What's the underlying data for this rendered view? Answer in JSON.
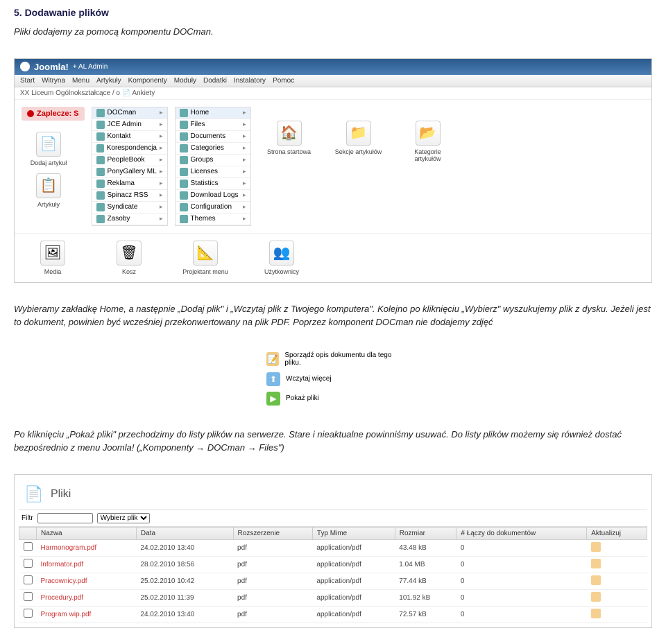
{
  "doc": {
    "heading": "5. Dodawanie plików",
    "para1": "Pliki dodajemy za pomocą komponentu DOCman.",
    "para2": "Wybieramy zakładkę Home, a następnie „Dodaj plik\" i „Wczytaj plik z Twojego komputera\". Kolejno po kliknięciu „Wybierz\" wyszukujemy plik z dysku. Jeżeli jest to dokument, powinien być wcześniej przekonwertowany na plik PDF. Poprzez komponent DOCman nie dodajemy zdjęć",
    "para3": "Po kliknięciu „Pokaż pliki\" przechodzimy do listy plików na serwerze. Stare i nieaktualne powinniśmy usuwać. Do listy plików możemy się również dostać bezpośrednio z menu Joomla! („Komponenty → DOCman → Files\")"
  },
  "joomla": {
    "brand": "Joomla!",
    "brand_suffix": " + AL Admin",
    "menu": [
      "Start",
      "Witryna",
      "Menu",
      "Artykuły",
      "Komponenty",
      "Moduły",
      "Dodatki",
      "Instalatory",
      "Pomoc"
    ],
    "breadcrumb": "XX Liceum Ogólnokształcące / o 📄 Ankiety",
    "zaplecze": "Zaplecze: S",
    "menu_col1": [
      {
        "label": "DOCman",
        "highlighted": true
      },
      {
        "label": "JCE Admin"
      },
      {
        "label": "Kontakt"
      },
      {
        "label": "Korespondencja"
      },
      {
        "label": "PeopleBook"
      },
      {
        "label": "PonyGallery ML"
      },
      {
        "label": "Reklama"
      },
      {
        "label": "Spinacz RSS"
      },
      {
        "label": "Syndicate"
      },
      {
        "label": "Zasoby"
      }
    ],
    "menu_col2": [
      {
        "label": "Home",
        "highlighted": true
      },
      {
        "label": "Files"
      },
      {
        "label": "Documents"
      },
      {
        "label": "Categories"
      },
      {
        "label": "Groups"
      },
      {
        "label": "Licenses"
      },
      {
        "label": "Statistics"
      },
      {
        "label": "Download Logs"
      },
      {
        "label": "Configuration"
      },
      {
        "label": "Themes"
      }
    ],
    "big_icons_top": [
      {
        "label": "Dodaj artykuł"
      },
      {
        "label": "Artykuły"
      }
    ],
    "big_icons_right": [
      {
        "label": "Strona startowa"
      },
      {
        "label": "Sekcje artykułów"
      },
      {
        "label": "Kategorie artykułów"
      }
    ],
    "bottom_icons": [
      {
        "label": "Media"
      },
      {
        "label": "Kosz"
      },
      {
        "label": "Projektant menu"
      },
      {
        "label": "Użytkownicy"
      }
    ]
  },
  "actions": {
    "doc": "Sporządź opis dokumentu dla tego pliku.",
    "upload": "Wczytaj więcej",
    "show": "Pokaż pliki"
  },
  "files": {
    "title": "Pliki",
    "filter_label": "Filtr",
    "filter_placeholder": "Wybierz plik",
    "columns": [
      "",
      "Nazwa",
      "Data",
      "Rozszerzenie",
      "Typ Mime",
      "Rozmiar",
      "# Łączy do dokumentów",
      "Aktualizuj"
    ],
    "rows": [
      {
        "name": "Harmonogram.pdf",
        "date": "24.02.2010 13:40",
        "ext": "pdf",
        "mime": "application/pdf",
        "size": "43.48 kB",
        "links": "0"
      },
      {
        "name": "Informator.pdf",
        "date": "28.02.2010 18:56",
        "ext": "pdf",
        "mime": "application/pdf",
        "size": "1.04 MB",
        "links": "0"
      },
      {
        "name": "Pracownicy.pdf",
        "date": "25.02.2010 10:42",
        "ext": "pdf",
        "mime": "application/pdf",
        "size": "77.44 kB",
        "links": "0"
      },
      {
        "name": "Procedury.pdf",
        "date": "25.02.2010 11:39",
        "ext": "pdf",
        "mime": "application/pdf",
        "size": "101.92 kB",
        "links": "0"
      },
      {
        "name": "Program wip.pdf",
        "date": "24.02.2010 13:40",
        "ext": "pdf",
        "mime": "application/pdf",
        "size": "72.57 kB",
        "links": "0"
      }
    ]
  }
}
